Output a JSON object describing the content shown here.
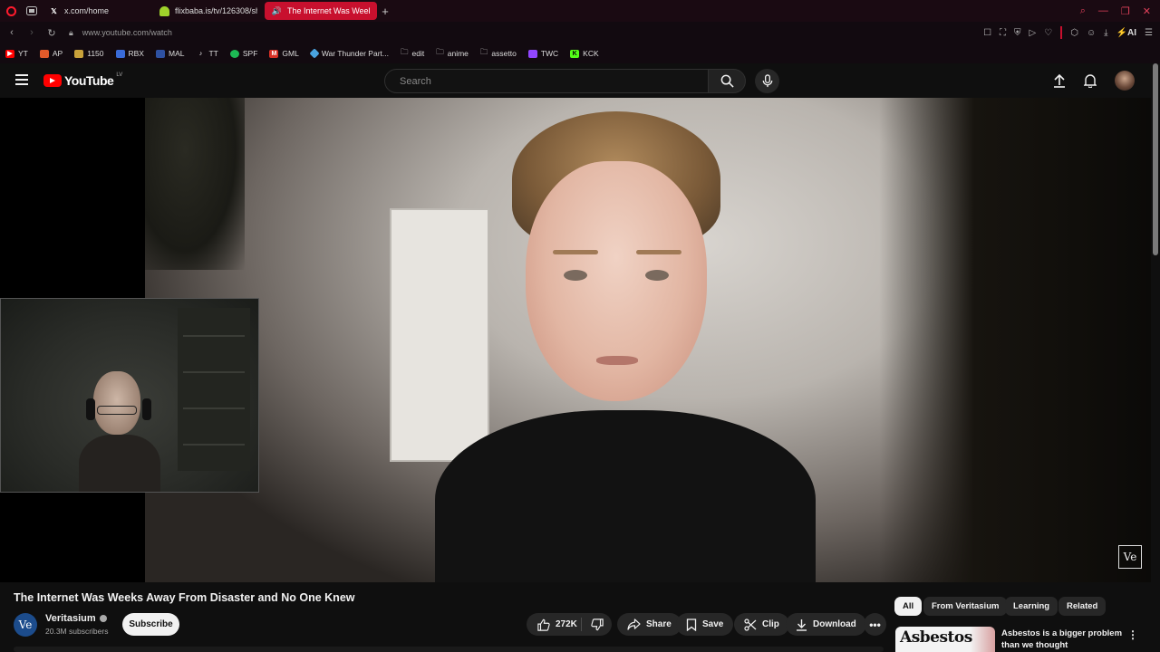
{
  "browser": {
    "tabs": [
      {
        "label": "x.com/home",
        "icon": "x-logo-icon",
        "active": false
      },
      {
        "label": "flixbaba.is/tv/126308/sh...",
        "icon": "android-icon",
        "active": false
      },
      {
        "label": "The Internet Was Week...",
        "icon": "youtube-icon",
        "active": true
      }
    ],
    "url": "www.youtube.com/watch",
    "bookmarks": [
      {
        "label": "YT",
        "color": "#ff0000"
      },
      {
        "label": "AP",
        "color": "#e05a2a"
      },
      {
        "label": "1150",
        "color": "#c8a13a"
      },
      {
        "label": "RBX",
        "color": "#3a6bd8"
      },
      {
        "label": "MAL",
        "color": "#2e51a2"
      },
      {
        "label": "TT",
        "color": "#222222"
      },
      {
        "label": "SPF",
        "color": "#1db954"
      },
      {
        "label": "GML",
        "color": "#d93025"
      },
      {
        "label": "War Thunder Part...",
        "color": "#4aa3df"
      },
      {
        "label": "edit",
        "color": "folder"
      },
      {
        "label": "anime",
        "color": "folder"
      },
      {
        "label": "assetto",
        "color": "folder"
      },
      {
        "label": "TWC",
        "color": "#9146ff"
      },
      {
        "label": "KCK",
        "color": "#53fc18"
      }
    ],
    "ai_label": "AI"
  },
  "youtube": {
    "logo_text": "YouTube",
    "country_code": "LV",
    "search_placeholder": "Search"
  },
  "video": {
    "watermark": "Ve",
    "title": "The Internet Was Weeks Away From Disaster and No One Knew",
    "channel": {
      "name": "Veritasium",
      "avatar_text": "Ve",
      "subscribers": "20.3M subscribers",
      "subscribe_label": "Subscribe"
    },
    "actions": {
      "likes": "272K",
      "share": "Share",
      "save": "Save",
      "clip": "Clip",
      "download": "Download"
    }
  },
  "sidebar": {
    "chips": [
      "All",
      "From Veritasium",
      "Learning",
      "Related"
    ],
    "selected_chip": "All",
    "recommendation": {
      "thumb_text": "Asbestos",
      "title": "Asbestos is a bigger problem than we thought"
    }
  }
}
